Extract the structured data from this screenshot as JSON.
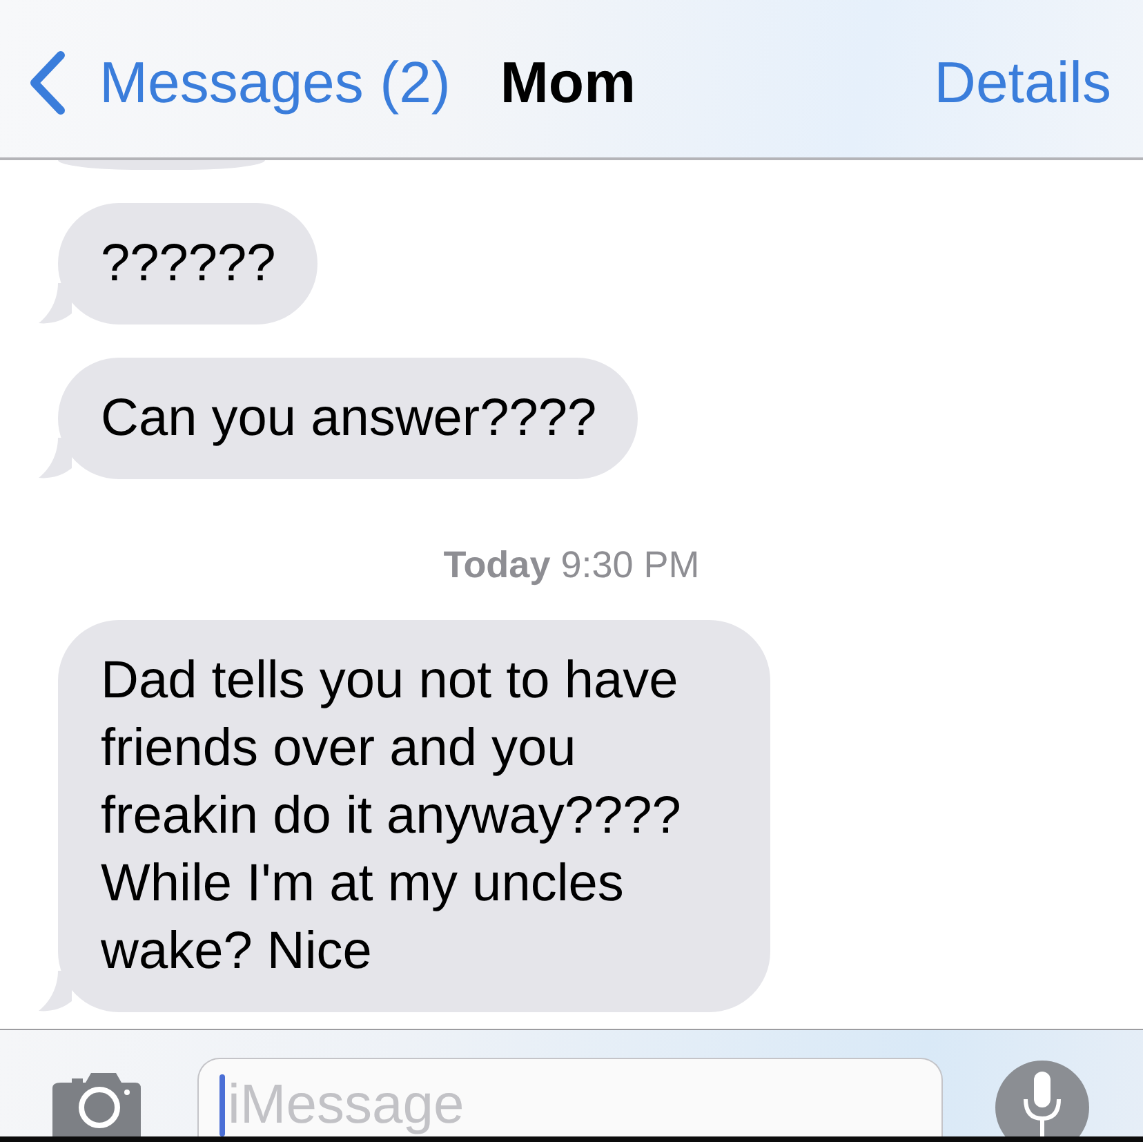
{
  "nav_bar": {
    "back_label": "Messages (2)",
    "title": "Mom",
    "action": "Details"
  },
  "messages": [
    {
      "kind": "clipped"
    },
    {
      "kind": "received",
      "text": "??????"
    },
    {
      "kind": "received",
      "text": "Can you answer????"
    },
    {
      "kind": "timestamp",
      "text": "**Today** 9:30 PM"
    },
    {
      "kind": "received",
      "text": "Dad tells you not to have friends over and you freakin do it anyway???? While I'm at my uncles wake? Nice"
    }
  ],
  "compose_bar": {
    "placeholder": "iMessage",
    "focused": true
  }
}
